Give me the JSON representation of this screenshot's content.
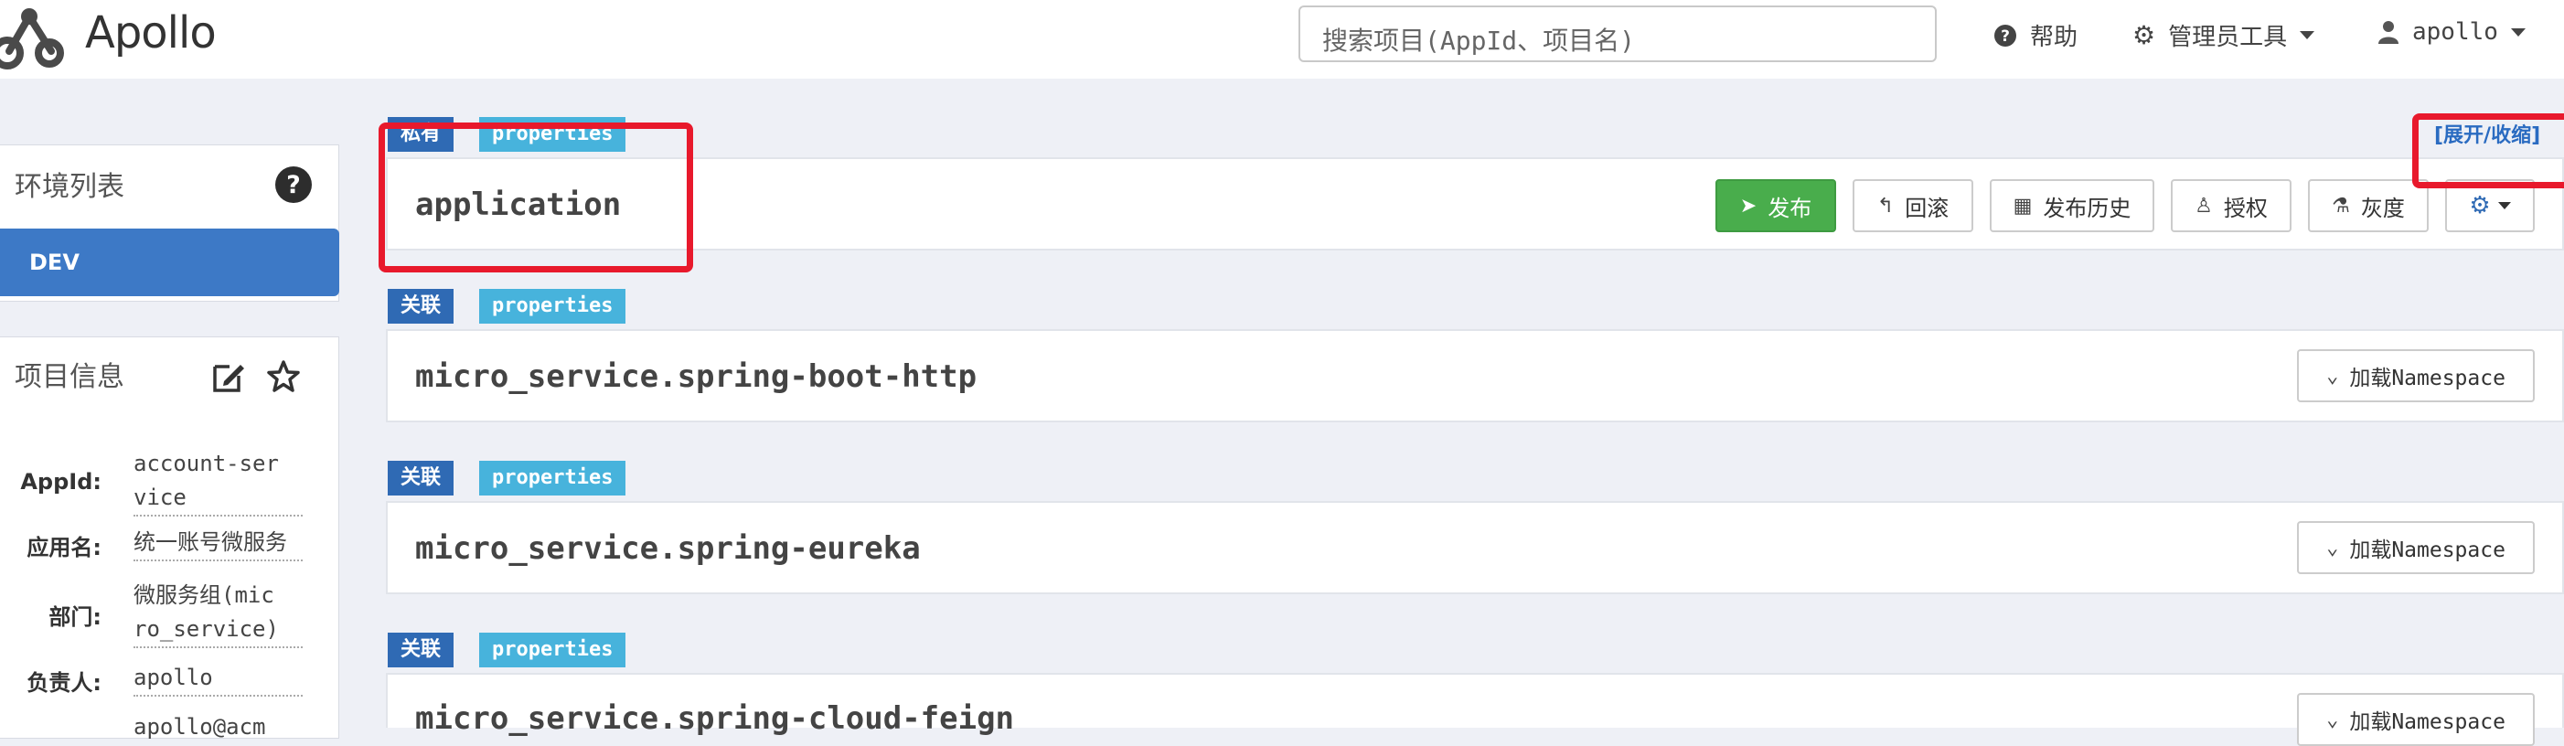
{
  "app": {
    "name": "Apollo"
  },
  "header": {
    "search_placeholder": "搜索项目(AppId、项目名)",
    "help_label": "帮助",
    "admin_tools_label": "管理员工具",
    "user_label": "apollo"
  },
  "sidebar": {
    "env_title": "环境列表",
    "envs": [
      "DEV"
    ],
    "project_title": "项目信息",
    "info": [
      {
        "key": "AppId:",
        "value": "account-ser\nvice"
      },
      {
        "key": "应用名:",
        "value": "统一账号微服务"
      },
      {
        "key": "部门:",
        "value": "微服务组(mic\nro_service)"
      },
      {
        "key": "负责人:",
        "value": "apollo"
      },
      {
        "key": "",
        "value": "apollo@acm"
      }
    ]
  },
  "toolbar": {
    "expand_collapse": "[展开/收缩]"
  },
  "namespaces": [
    {
      "scope_tag": "私有",
      "format_tag": "properties",
      "name": "application",
      "actions": {
        "publish": "发布",
        "rollback": "回滚",
        "publish_history": "发布历史",
        "authorize": "授权",
        "gray": "灰度"
      }
    },
    {
      "scope_tag": "关联",
      "format_tag": "properties",
      "name": "micro_service.spring-boot-http",
      "load_label": "加载Namespace"
    },
    {
      "scope_tag": "关联",
      "format_tag": "properties",
      "name": "micro_service.spring-eureka",
      "load_label": "加载Namespace"
    },
    {
      "scope_tag": "关联",
      "format_tag": "properties",
      "name": "micro_service.spring-cloud-feign",
      "load_label": "加载Namespace"
    }
  ],
  "colors": {
    "primary": "#3d79c6",
    "success": "#49ad4c",
    "tag_dark": "#2f6ab4",
    "tag_light": "#47b3dc",
    "highlight": "#e8192c"
  },
  "icons": [
    "apollo-logo-icon",
    "help-icon",
    "gear-icon",
    "user-icon",
    "edit-icon",
    "star-icon",
    "send-icon",
    "rollback-icon",
    "calendar-icon",
    "user-icon",
    "flask-icon",
    "chevrons-down-icon"
  ]
}
